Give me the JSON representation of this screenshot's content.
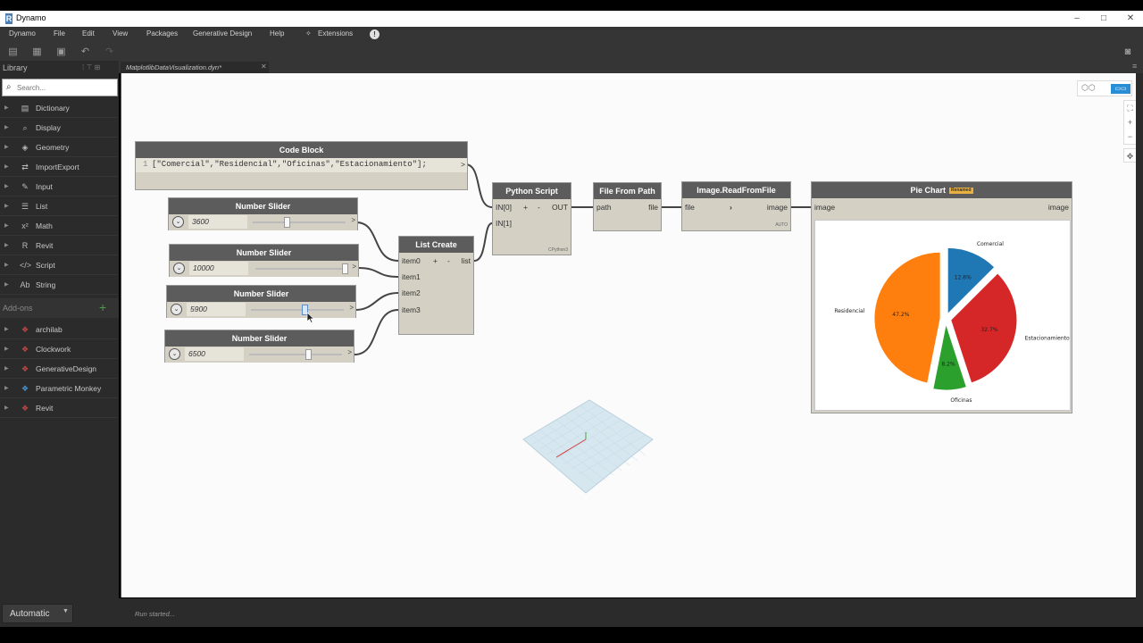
{
  "window": {
    "title": "Dynamo",
    "app_letter": "R"
  },
  "menu": {
    "items": [
      "Dynamo",
      "File",
      "Edit",
      "View",
      "Packages",
      "Generative Design",
      "Help",
      "Extensions"
    ]
  },
  "library": {
    "title": "Library",
    "search_placeholder": "Search...",
    "items": [
      {
        "label": "Dictionary",
        "icon": "dictionary-icon"
      },
      {
        "label": "Display",
        "icon": "display-icon"
      },
      {
        "label": "Geometry",
        "icon": "geometry-icon"
      },
      {
        "label": "ImportExport",
        "icon": "import-export-icon"
      },
      {
        "label": "Input",
        "icon": "input-icon"
      },
      {
        "label": "List",
        "icon": "list-icon"
      },
      {
        "label": "Math",
        "icon": "math-icon"
      },
      {
        "label": "Revit",
        "icon": "revit-icon"
      },
      {
        "label": "Script",
        "icon": "script-icon"
      },
      {
        "label": "String",
        "icon": "string-icon"
      }
    ],
    "addons_title": "Add-ons",
    "addons": [
      {
        "label": "archilab",
        "icon": "package-icon"
      },
      {
        "label": "Clockwork",
        "icon": "package-icon"
      },
      {
        "label": "GenerativeDesign",
        "icon": "package-icon"
      },
      {
        "label": "Parametric Monkey",
        "icon": "package-icon"
      },
      {
        "label": "Revit",
        "icon": "package-icon"
      }
    ]
  },
  "tab": {
    "label": "MatplotlibDataVisualization.dyn*"
  },
  "nodes": {
    "code_block": {
      "title": "Code Block",
      "line_number": "1",
      "code": "[\"Comercial\",\"Residencial\",\"Oficinas\",\"Estacionamiento\"];",
      "out": ">"
    },
    "sliders": [
      {
        "title": "Number Slider",
        "value": "3600",
        "level": 0.36
      },
      {
        "title": "Number Slider",
        "value": "10000",
        "level": 1.0
      },
      {
        "title": "Number Slider",
        "value": "5900",
        "level": 0.59
      },
      {
        "title": "Number Slider",
        "value": "6500",
        "level": 0.65
      }
    ],
    "list_create": {
      "title": "List Create",
      "inputs": [
        "item0",
        "item1",
        "item2",
        "item3"
      ],
      "output": "list",
      "plus": "+",
      "minus": "-"
    },
    "python_script": {
      "title": "Python Script",
      "inputs": [
        "IN[0]",
        "IN[1]"
      ],
      "output": "OUT",
      "plus": "+",
      "minus": "-",
      "engine": "CPython3"
    },
    "file_from_path": {
      "title": "File From Path",
      "input": "path",
      "output": "file"
    },
    "image_read": {
      "title": "Image.ReadFromFile",
      "input": "file",
      "output": "image",
      "lacing": "AUTO"
    },
    "pie_chart": {
      "title": "Pie Chart",
      "badge": "Renamed",
      "input": "image",
      "output": "image"
    }
  },
  "chart_data": {
    "type": "pie",
    "categories": [
      "Comercial",
      "Estacionamiento",
      "Oficinas",
      "Residencial"
    ],
    "values": [
      12.6,
      32.7,
      8.2,
      47.2
    ],
    "labels": [
      "12.6%",
      "32.7%",
      "8.2%",
      "47.2%"
    ],
    "colors": [
      "#1f77b4",
      "#d62728",
      "#2ca02c",
      "#ff7f0e"
    ]
  },
  "status": {
    "run_mode": "Automatic",
    "message": "Run started..."
  }
}
